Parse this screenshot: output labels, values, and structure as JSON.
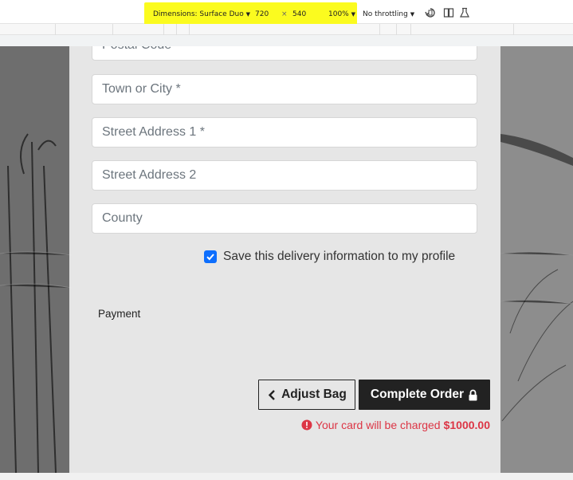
{
  "devtools": {
    "dimensions_label": "Dimensions: Surface Duo",
    "width_value": "720",
    "times_symbol": "×",
    "height_value": "540",
    "zoom": "100%",
    "throttling": "No throttling",
    "highlight_color": "#fbfb1f",
    "icons": [
      "rotate-icon",
      "dual-screen-icon",
      "sensors-icon"
    ]
  },
  "form": {
    "postal_code_placeholder": "Postal Code",
    "town_placeholder": "Town or City *",
    "street1_placeholder": "Street Address 1 *",
    "street2_placeholder": "Street Address 2",
    "county_placeholder": "County",
    "save_info_label": "Save this delivery information to my profile",
    "save_info_checked": true,
    "checkbox_color": "#0d6efd"
  },
  "payment": {
    "section_label": "Payment"
  },
  "actions": {
    "adjust_bag_label": "Adjust Bag",
    "complete_order_label": "Complete Order",
    "charge_notice_prefix": "Your card will be charged",
    "charge_amount": "$1000.00",
    "charge_color": "#dc3545"
  }
}
